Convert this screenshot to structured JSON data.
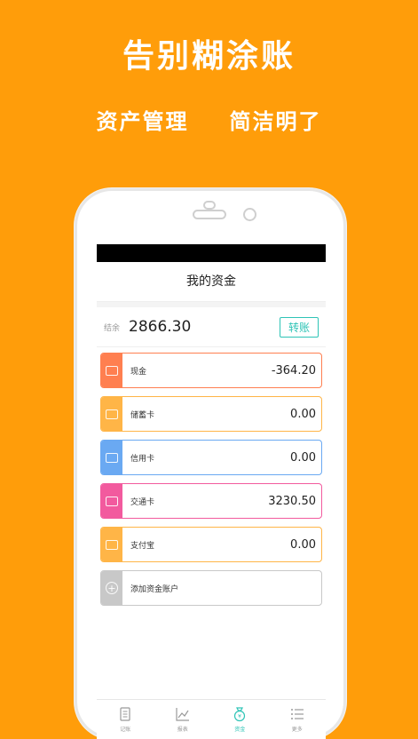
{
  "headline": "告别糊涂账",
  "subline": {
    "left": "资产管理",
    "right": "简洁明了"
  },
  "app": {
    "title": "我的资金",
    "balance": {
      "label": "结余",
      "value": "2866.30",
      "transfer_label": "转账"
    },
    "accounts": [
      {
        "name": "现金",
        "amount": "-364.20",
        "color": "#FF7F50",
        "icon": "cash-icon"
      },
      {
        "name": "储蓄卡",
        "amount": "0.00",
        "color": "#FFB547",
        "icon": "debit-card-icon"
      },
      {
        "name": "信用卡",
        "amount": "0.00",
        "color": "#6AA9F2",
        "icon": "credit-card-icon"
      },
      {
        "name": "交通卡",
        "amount": "3230.50",
        "color": "#F25A9E",
        "icon": "transit-card-icon"
      },
      {
        "name": "支付宝",
        "amount": "0.00",
        "color": "#FFB547",
        "icon": "alipay-icon"
      },
      {
        "name": "添加资金账户",
        "amount": "",
        "color": "#C8C8C8",
        "icon": "add-icon"
      }
    ],
    "tabs": [
      {
        "label": "记账",
        "icon": "notebook-icon"
      },
      {
        "label": "报表",
        "icon": "chart-icon"
      },
      {
        "label": "资金",
        "icon": "money-bag-icon",
        "active": true
      },
      {
        "label": "更多",
        "icon": "more-list-icon"
      }
    ],
    "accent_color": "#2EC4B6",
    "background_color": "#FF9D0A"
  }
}
